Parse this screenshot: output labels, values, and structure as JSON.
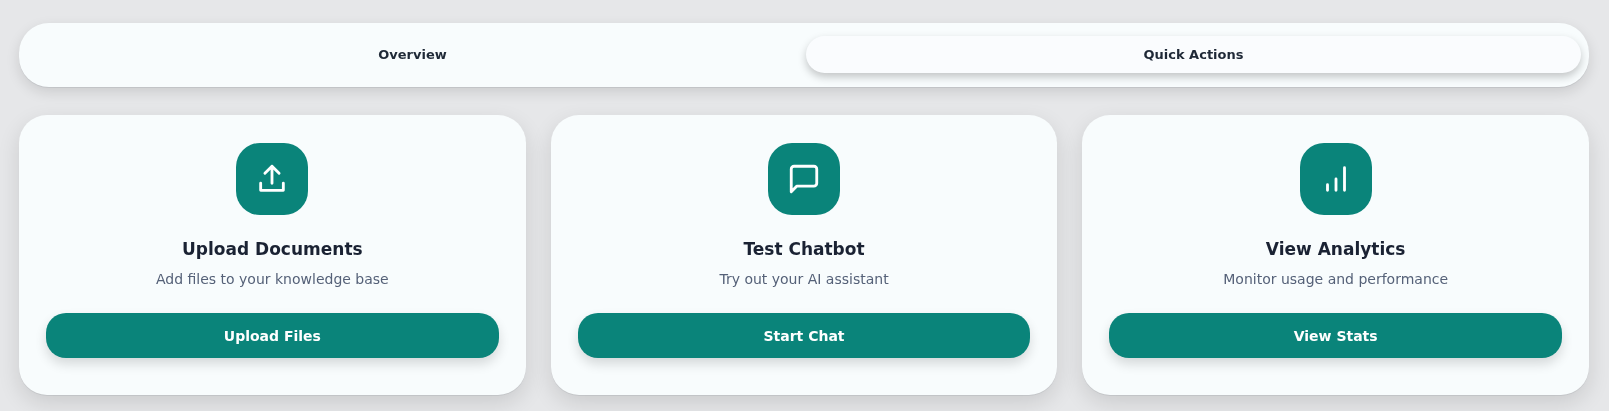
{
  "tabs": [
    {
      "label": "Overview",
      "selected": false
    },
    {
      "label": "Quick Actions",
      "selected": true
    }
  ],
  "actions": [
    {
      "kind": "upload",
      "title": "Upload Documents",
      "description": "Add files to your knowledge base",
      "button": "Upload Files"
    },
    {
      "kind": "chat",
      "title": "Test Chatbot",
      "description": "Try out your AI assistant",
      "button": "Start Chat"
    },
    {
      "kind": "analytics",
      "title": "View Analytics",
      "description": "Monitor usage and performance",
      "button": "View Stats"
    }
  ]
}
